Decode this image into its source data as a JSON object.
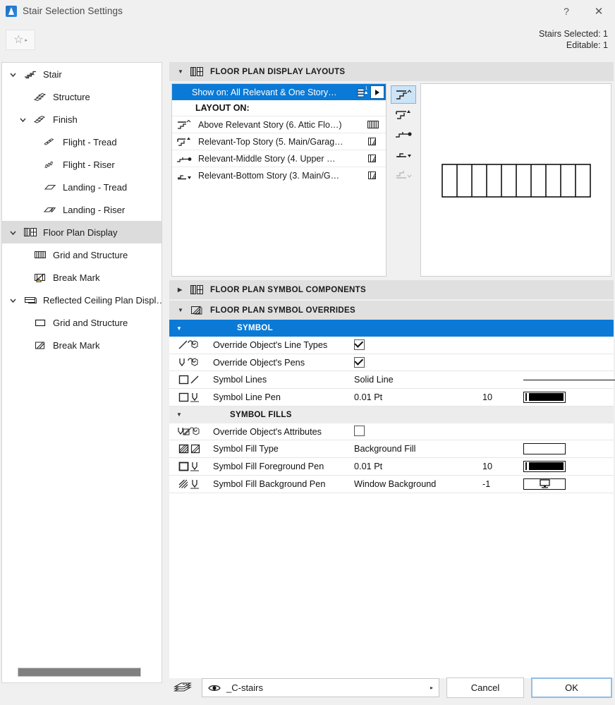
{
  "window": {
    "title": "Stair Selection Settings",
    "icon": "archicad-stair-icon",
    "help_label": "?",
    "close_label": "✕"
  },
  "toolbar": {
    "favorites_icon": "star-icon",
    "favorites_caret": "▸",
    "stairs_selected": "Stairs Selected: 1",
    "editable": "Editable: 1"
  },
  "sidebar": {
    "items": [
      {
        "label": "Stair",
        "icon": "stair-icon",
        "indent": 0,
        "twisty": "down",
        "selected": false
      },
      {
        "label": "Structure",
        "icon": "structure-icon",
        "indent": 1,
        "twisty": "none",
        "selected": false
      },
      {
        "label": "Finish",
        "icon": "finish-icon",
        "indent": 1,
        "twisty": "down",
        "selected": false
      },
      {
        "label": "Flight - Tread",
        "icon": "flight-tread-icon",
        "indent": 2,
        "twisty": "none",
        "selected": false
      },
      {
        "label": "Flight - Riser",
        "icon": "flight-riser-icon",
        "indent": 2,
        "twisty": "none",
        "selected": false
      },
      {
        "label": "Landing - Tread",
        "icon": "landing-tread-icon",
        "indent": 2,
        "twisty": "none",
        "selected": false
      },
      {
        "label": "Landing - Riser",
        "icon": "landing-riser-icon",
        "indent": 2,
        "twisty": "none",
        "selected": false
      },
      {
        "label": "Floor Plan Display",
        "icon": "floor-plan-display-icon",
        "indent": 0,
        "twisty": "down",
        "selected": true
      },
      {
        "label": "Grid and Structure",
        "icon": "grid-structure-icon",
        "indent": 1,
        "twisty": "none",
        "selected": false
      },
      {
        "label": "Break Mark",
        "icon": "break-mark-icon",
        "indent": 1,
        "twisty": "none",
        "selected": false
      },
      {
        "label": "Reflected Ceiling Plan Displ…",
        "icon": "rcp-display-icon",
        "indent": 0,
        "twisty": "down",
        "selected": false
      },
      {
        "label": "Grid and Structure",
        "icon": "rcp-grid-icon",
        "indent": 1,
        "twisty": "none",
        "selected": false
      },
      {
        "label": "Break Mark",
        "icon": "rcp-break-mark-icon",
        "indent": 1,
        "twisty": "none",
        "selected": false
      }
    ]
  },
  "panels": {
    "layouts": {
      "title": "FLOOR PLAN DISPLAY LAYOUTS",
      "icon": "floor-plan-display-icon",
      "expanded": true,
      "show_on": {
        "label": "Show on: All Relevant & One Story…",
        "icon": "story-selector-icon",
        "arrow": "▶"
      },
      "layout_on_label": "LAYOUT ON:",
      "rows": [
        {
          "icon": "above-relevant-icon",
          "label": "Above Relevant Story (6.   Attic Flo…)",
          "right_icon": "grid-hatched-icon"
        },
        {
          "icon": "relevant-top-icon",
          "label": "Relevant-Top Story (5. Main/Garag…",
          "right_icon": "stair-block-icon"
        },
        {
          "icon": "relevant-middle-icon",
          "label": "Relevant-Middle Story (4.   Upper …",
          "right_icon": "stair-block-icon"
        },
        {
          "icon": "relevant-bottom-icon",
          "label": "Relevant-Bottom Story (3. Main/G…",
          "right_icon": "stair-block-icon"
        }
      ],
      "icon_buttons": [
        {
          "name": "above-relevant-story-button",
          "active": true,
          "enabled": true
        },
        {
          "name": "relevant-top-story-button",
          "active": false,
          "enabled": true
        },
        {
          "name": "relevant-middle-story-button",
          "active": false,
          "enabled": true
        },
        {
          "name": "relevant-bottom-story-button",
          "active": false,
          "enabled": true
        },
        {
          "name": "below-relevant-story-button",
          "active": false,
          "enabled": false
        }
      ],
      "preview": {
        "name": "stair-plan-preview",
        "tread_count": 10
      }
    },
    "components": {
      "title": "FLOOR PLAN SYMBOL COMPONENTS",
      "icon": "floor-plan-display-icon",
      "expanded": false
    },
    "overrides": {
      "title": "FLOOR PLAN SYMBOL OVERRIDES",
      "icon": "symbol-overrides-icon",
      "expanded": true,
      "groups": [
        {
          "title": "SYMBOL",
          "highlighted": true,
          "rows": [
            {
              "icon": "override-line-types-icon",
              "label": "Override Object's Line Types",
              "value": "",
              "number": "",
              "control": "checkbox",
              "checked": true
            },
            {
              "icon": "override-pens-icon",
              "label": "Override Object's Pens",
              "value": "",
              "number": "",
              "control": "checkbox",
              "checked": true
            },
            {
              "icon": "symbol-lines-icon",
              "label": "Symbol Lines",
              "value": "Solid Line",
              "number": "",
              "control": "line"
            },
            {
              "icon": "symbol-line-pen-icon",
              "label": "Symbol Line Pen",
              "value": "0.01 Pt",
              "number": "10",
              "control": "pen"
            }
          ]
        },
        {
          "title": "SYMBOL FILLS",
          "highlighted": false,
          "rows": [
            {
              "icon": "override-attributes-icon",
              "label": "Override Object's Attributes",
              "value": "",
              "number": "",
              "control": "checkbox",
              "checked": false
            },
            {
              "icon": "symbol-fill-type-icon",
              "label": "Symbol Fill Type",
              "value": "Background Fill",
              "number": "",
              "control": "fill"
            },
            {
              "icon": "fill-foreground-pen-icon",
              "label": "Symbol Fill Foreground Pen",
              "value": "0.01 Pt",
              "number": "10",
              "control": "pen"
            },
            {
              "icon": "fill-background-pen-icon",
              "label": "Symbol Fill Background Pen",
              "value": "Window Background",
              "number": "-1",
              "control": "window"
            }
          ]
        }
      ]
    }
  },
  "footer": {
    "layers_icon": "layers-icon",
    "layer_eye_icon": "eye-icon",
    "layer_name": "_C-stairs",
    "layer_arrow": "▸",
    "cancel_label": "Cancel",
    "ok_label": "OK"
  },
  "colors": {
    "accent_blue": "#0b7ad6",
    "selection_gray": "#dcdcdc",
    "panel_header": "#e0e0e0",
    "window_bg": "#f0f0f0"
  }
}
